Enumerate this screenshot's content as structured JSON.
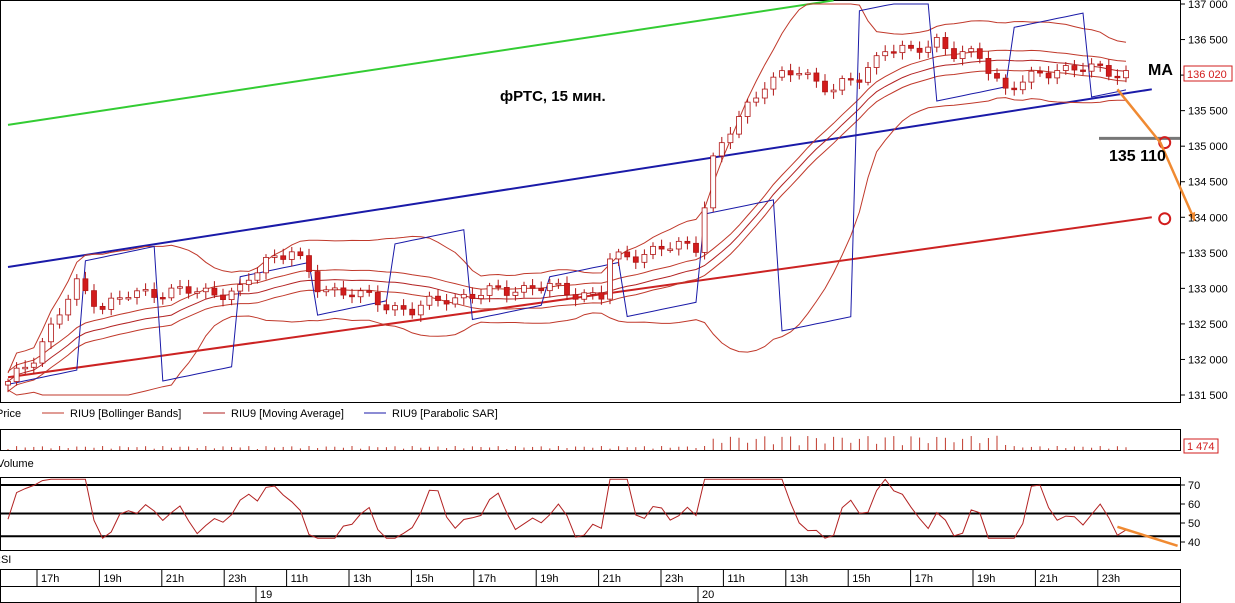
{
  "chart_data": {
    "type": "candlestick",
    "annotation_title": "фРТС,  15 мин.",
    "ma_label": "MA",
    "level_label": "135 110",
    "current_price_label": "136 020",
    "volume_current_label": "1 474",
    "legend": {
      "price": "Price",
      "bollinger": "RIU9 [Bollinger Bands]",
      "ma": "RIU9 [Moving Average]",
      "sar": "RIU9 [Parabolic SAR]",
      "volume": "Volume",
      "rsi": "RSI"
    },
    "price_axis": {
      "min": 131500,
      "max": 137000,
      "ticks": [
        "131 500",
        "132 000",
        "132 500",
        "133 000",
        "133 500",
        "134 000",
        "134 500",
        "135 000",
        "135 500",
        "136 000",
        "136 500",
        "137 000"
      ]
    },
    "rsi_axis": {
      "min": 35,
      "max": 75,
      "ticks": [
        "40",
        "50",
        "60",
        "70"
      ],
      "levels": [
        70,
        55,
        43
      ]
    },
    "time_axis": {
      "labels": [
        "17h",
        "19h",
        "21h",
        "23h",
        "11h",
        "13h",
        "15h",
        "17h",
        "19h",
        "21h",
        "23h",
        "11h",
        "13h",
        "15h",
        "17h",
        "19h",
        "21h",
        "23h"
      ],
      "days": [
        "19",
        "20"
      ]
    },
    "channels": [
      {
        "name": "green",
        "color": "#33cc33",
        "points": [
          [
            0,
            135300
          ],
          [
            96,
            137050
          ]
        ]
      },
      {
        "name": "blue",
        "color": "#1a1aa8",
        "points": [
          [
            0,
            133300
          ],
          [
            133,
            135800
          ]
        ]
      },
      {
        "name": "red",
        "color": "#cc2222",
        "points": [
          [
            0,
            131750
          ],
          [
            133,
            134000
          ]
        ]
      }
    ],
    "markers": [
      {
        "name": "level-marker",
        "bar": 134.5,
        "price": 135050
      },
      {
        "name": "channel-marker",
        "bar": 134.5,
        "price": 133980
      }
    ],
    "forecast_arrow": [
      [
        129,
        135800
      ],
      [
        134,
        135050
      ],
      [
        138,
        133950
      ]
    ],
    "rsi_arrow": [
      [
        129,
        48
      ],
      [
        136,
        38
      ]
    ],
    "colors": {
      "candle_up": "#ffffff",
      "candle_down": "#d21c1c",
      "candle_outline": "#b01515",
      "bollinger": "#c0392b",
      "moving_average": "#b22222",
      "sar": "#1a1aa8",
      "rsi_line": "#b22222",
      "volume": "#c0392b",
      "forecast_arrow": "#f08a32",
      "price_tag": "#d21c1c"
    }
  }
}
